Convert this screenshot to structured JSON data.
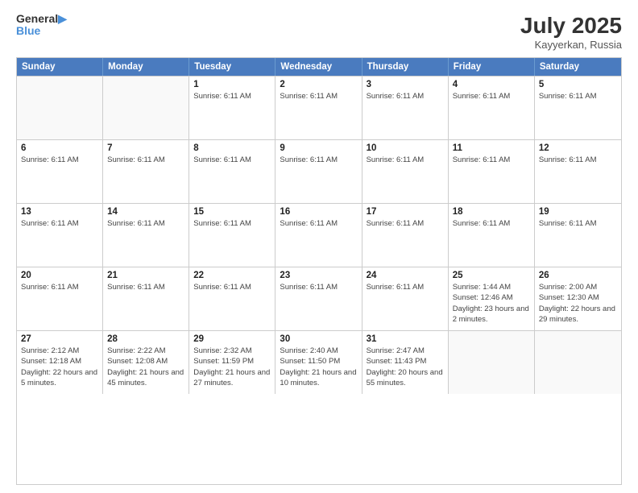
{
  "header": {
    "logo_line1": "General",
    "logo_line2": "Blue",
    "month_year": "July 2025",
    "location": "Kayyerkan, Russia"
  },
  "days_of_week": [
    "Sunday",
    "Monday",
    "Tuesday",
    "Wednesday",
    "Thursday",
    "Friday",
    "Saturday"
  ],
  "weeks": [
    [
      {
        "day": "",
        "info": ""
      },
      {
        "day": "",
        "info": ""
      },
      {
        "day": "1",
        "info": "Sunrise: 6:11 AM"
      },
      {
        "day": "2",
        "info": "Sunrise: 6:11 AM"
      },
      {
        "day": "3",
        "info": "Sunrise: 6:11 AM"
      },
      {
        "day": "4",
        "info": "Sunrise: 6:11 AM"
      },
      {
        "day": "5",
        "info": "Sunrise: 6:11 AM"
      }
    ],
    [
      {
        "day": "6",
        "info": "Sunrise: 6:11 AM"
      },
      {
        "day": "7",
        "info": "Sunrise: 6:11 AM"
      },
      {
        "day": "8",
        "info": "Sunrise: 6:11 AM"
      },
      {
        "day": "9",
        "info": "Sunrise: 6:11 AM"
      },
      {
        "day": "10",
        "info": "Sunrise: 6:11 AM"
      },
      {
        "day": "11",
        "info": "Sunrise: 6:11 AM"
      },
      {
        "day": "12",
        "info": "Sunrise: 6:11 AM"
      }
    ],
    [
      {
        "day": "13",
        "info": "Sunrise: 6:11 AM"
      },
      {
        "day": "14",
        "info": "Sunrise: 6:11 AM"
      },
      {
        "day": "15",
        "info": "Sunrise: 6:11 AM"
      },
      {
        "day": "16",
        "info": "Sunrise: 6:11 AM"
      },
      {
        "day": "17",
        "info": "Sunrise: 6:11 AM"
      },
      {
        "day": "18",
        "info": "Sunrise: 6:11 AM"
      },
      {
        "day": "19",
        "info": "Sunrise: 6:11 AM"
      }
    ],
    [
      {
        "day": "20",
        "info": "Sunrise: 6:11 AM"
      },
      {
        "day": "21",
        "info": "Sunrise: 6:11 AM"
      },
      {
        "day": "22",
        "info": "Sunrise: 6:11 AM"
      },
      {
        "day": "23",
        "info": "Sunrise: 6:11 AM"
      },
      {
        "day": "24",
        "info": "Sunrise: 6:11 AM"
      },
      {
        "day": "25",
        "info": "Sunrise: 1:44 AM\nSunset: 12:46 AM\nDaylight: 23 hours and 2 minutes."
      },
      {
        "day": "26",
        "info": "Sunrise: 2:00 AM\nSunset: 12:30 AM\nDaylight: 22 hours and 29 minutes."
      }
    ],
    [
      {
        "day": "27",
        "info": "Sunrise: 2:12 AM\nSunset: 12:18 AM\nDaylight: 22 hours and 5 minutes."
      },
      {
        "day": "28",
        "info": "Sunrise: 2:22 AM\nSunset: 12:08 AM\nDaylight: 21 hours and 45 minutes."
      },
      {
        "day": "29",
        "info": "Sunrise: 2:32 AM\nSunset: 11:59 PM\nDaylight: 21 hours and 27 minutes."
      },
      {
        "day": "30",
        "info": "Sunrise: 2:40 AM\nSunset: 11:50 PM\nDaylight: 21 hours and 10 minutes."
      },
      {
        "day": "31",
        "info": "Sunrise: 2:47 AM\nSunset: 11:43 PM\nDaylight: 20 hours and 55 minutes."
      },
      {
        "day": "",
        "info": ""
      },
      {
        "day": "",
        "info": ""
      }
    ]
  ]
}
